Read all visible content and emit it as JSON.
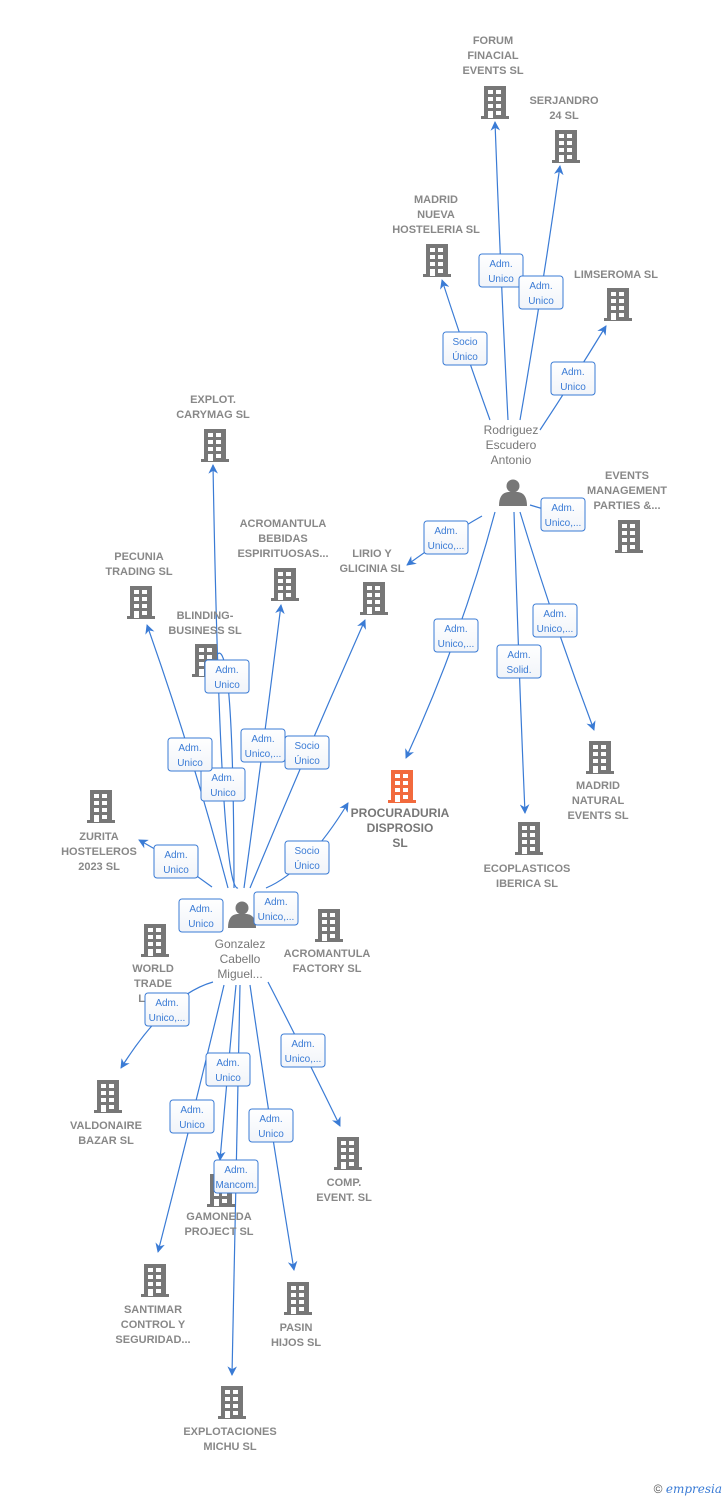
{
  "colors": {
    "edge": "#3a7bd5",
    "node": "#777777",
    "main_node": "#f26a3d",
    "label_border": "#3a7bd5"
  },
  "nodes": [
    {
      "id": "forum",
      "type": "company",
      "icon": "building-icon",
      "lines": [
        "FORUM",
        "FINACIAL",
        "EVENTS  SL"
      ]
    },
    {
      "id": "serjandro",
      "type": "company",
      "icon": "building-icon",
      "lines": [
        "SERJANDRO",
        "24 SL"
      ]
    },
    {
      "id": "madrid_nueva",
      "type": "company",
      "icon": "building-icon",
      "lines": [
        "MADRID",
        "NUEVA",
        "HOSTELERIA SL"
      ]
    },
    {
      "id": "limseroma",
      "type": "company",
      "icon": "building-icon",
      "lines": [
        "LIMSEROMA SL"
      ]
    },
    {
      "id": "rodriguez",
      "type": "person",
      "icon": "person-icon",
      "lines": [
        "Rodriguez",
        "Escudero",
        "Antonio"
      ]
    },
    {
      "id": "events_mgmt",
      "type": "company",
      "icon": "building-icon",
      "lines": [
        "EVENTS",
        "MANAGEMENT",
        "PARTIES &..."
      ]
    },
    {
      "id": "explot_carymag",
      "type": "company",
      "icon": "building-icon",
      "lines": [
        "EXPLOT.",
        "CARYMAG SL"
      ]
    },
    {
      "id": "acromantula_bebidas",
      "type": "company",
      "icon": "building-icon",
      "lines": [
        "ACROMANTULA",
        "BEBIDAS",
        "ESPIRITUOSAS..."
      ]
    },
    {
      "id": "pecunia",
      "type": "company",
      "icon": "building-icon",
      "lines": [
        "PECUNIA",
        "TRADING  SL"
      ]
    },
    {
      "id": "lirio",
      "type": "company",
      "icon": "building-icon",
      "lines": [
        "LIRIO Y",
        "GLICINIA  SL"
      ]
    },
    {
      "id": "blinding",
      "type": "company",
      "icon": "building-icon",
      "lines": [
        "BLINDING-",
        "BUSINESS  SL"
      ]
    },
    {
      "id": "procuraduria",
      "type": "main",
      "icon": "building-icon",
      "lines": [
        "PROCURADURIA",
        "DISPROSIO",
        "SL"
      ]
    },
    {
      "id": "madrid_natural",
      "type": "company",
      "icon": "building-icon",
      "lines": [
        "MADRID",
        "NATURAL",
        "EVENTS  SL"
      ]
    },
    {
      "id": "ecoplasticos",
      "type": "company",
      "icon": "building-icon",
      "lines": [
        "ECOPLASTICOS",
        "IBERICA  SL"
      ]
    },
    {
      "id": "zurita",
      "type": "company",
      "icon": "building-icon",
      "lines": [
        "ZURITA",
        "HOSTELEROS",
        "2023  SL"
      ]
    },
    {
      "id": "gonzalez",
      "type": "person",
      "icon": "person-icon",
      "lines": [
        "Gonzalez",
        "Cabello",
        "Miguel..."
      ]
    },
    {
      "id": "acromantula_factory",
      "type": "company",
      "icon": "building-icon",
      "lines": [
        "ACROMANTULA",
        "FACTORY  SL"
      ]
    },
    {
      "id": "world_trade",
      "type": "company",
      "icon": "building-icon",
      "lines": [
        "WORLD",
        "TRADE",
        "LEV..."
      ]
    },
    {
      "id": "valdonaire",
      "type": "company",
      "icon": "building-icon",
      "lines": [
        "VALDONAIRE",
        "BAZAR  SL"
      ]
    },
    {
      "id": "comp_event",
      "type": "company",
      "icon": "building-icon",
      "lines": [
        "COMP.",
        "EVENT.  SL"
      ]
    },
    {
      "id": "gamoneda",
      "type": "company",
      "icon": "building-icon",
      "lines": [
        "GAMONEDA",
        "PROJECT  SL"
      ]
    },
    {
      "id": "santimar",
      "type": "company",
      "icon": "building-icon",
      "lines": [
        "SANTIMAR",
        "CONTROL Y",
        "SEGURIDAD..."
      ]
    },
    {
      "id": "pasin",
      "type": "company",
      "icon": "building-icon",
      "lines": [
        "PASIN",
        "HIJOS SL"
      ]
    },
    {
      "id": "michu",
      "type": "company",
      "icon": "building-icon",
      "lines": [
        "EXPLOTACIONES",
        "MICHU SL"
      ]
    }
  ],
  "edges": [
    {
      "id": "e1",
      "from": "rodriguez",
      "to": "forum",
      "label": [
        "Adm.",
        "Unico"
      ]
    },
    {
      "id": "e2",
      "from": "rodriguez",
      "to": "serjandro",
      "label": [
        "Adm.",
        "Unico"
      ]
    },
    {
      "id": "e3",
      "from": "rodriguez",
      "to": "madrid_nueva",
      "label": [
        "Socio",
        "Único"
      ]
    },
    {
      "id": "e4",
      "from": "rodriguez",
      "to": "limseroma",
      "label": [
        "Adm.",
        "Unico"
      ]
    },
    {
      "id": "e5",
      "from": "rodriguez",
      "to": "lirio",
      "label": [
        "Adm.",
        "Unico,..."
      ]
    },
    {
      "id": "e6",
      "from": "rodriguez",
      "to": "events_mgmt",
      "label": [
        "Adm.",
        "Unico,..."
      ]
    },
    {
      "id": "e7",
      "from": "rodriguez",
      "to": "procuraduria",
      "label": [
        "Adm.",
        "Unico,..."
      ]
    },
    {
      "id": "e8",
      "from": "rodriguez",
      "to": "ecoplasticos",
      "label": [
        "Adm.",
        "Solid."
      ]
    },
    {
      "id": "e9",
      "from": "rodriguez",
      "to": "madrid_natural",
      "label": [
        "Adm.",
        "Unico,..."
      ]
    },
    {
      "id": "e10",
      "from": "gonzalez",
      "to": "explot_carymag",
      "label": [
        "Adm.",
        "Unico"
      ]
    },
    {
      "id": "e11",
      "from": "gonzalez",
      "to": "pecunia",
      "label": [
        "Adm.",
        "Unico"
      ]
    },
    {
      "id": "e12",
      "from": "gonzalez",
      "to": "blinding",
      "label": [
        "Adm.",
        "Unico"
      ]
    },
    {
      "id": "e13",
      "from": "gonzalez",
      "to": "acromantula_bebidas",
      "label": [
        "Adm.",
        "Unico,..."
      ]
    },
    {
      "id": "e14",
      "from": "gonzalez",
      "to": "lirio",
      "label": [
        "Socio",
        "Único"
      ]
    },
    {
      "id": "e15",
      "from": "gonzalez",
      "to": "zurita",
      "label": [
        "Adm.",
        "Unico"
      ]
    },
    {
      "id": "e16",
      "from": "gonzalez",
      "to": "procuraduria",
      "label": [
        "Socio",
        "Único"
      ]
    },
    {
      "id": "e17",
      "from": "gonzalez",
      "to": "world_trade",
      "label": [
        "Adm.",
        "Unico"
      ]
    },
    {
      "id": "e18",
      "from": "gonzalez",
      "to": "acromantula_factory",
      "label": [
        "Adm.",
        "Unico,..."
      ]
    },
    {
      "id": "e19",
      "from": "gonzalez",
      "to": "valdonaire",
      "label": [
        "Adm.",
        "Unico,..."
      ]
    },
    {
      "id": "e20",
      "from": "gonzalez",
      "to": "comp_event",
      "label": [
        "Adm.",
        "Unico,..."
      ]
    },
    {
      "id": "e21",
      "from": "gonzalez",
      "to": "gamoneda",
      "label": [
        "Adm.",
        "Unico"
      ]
    },
    {
      "id": "e22",
      "from": "gonzalez",
      "to": "santimar",
      "label": [
        "Adm.",
        "Unico"
      ]
    },
    {
      "id": "e23",
      "from": "gonzalez",
      "to": "pasin",
      "label": [
        "Adm.",
        "Unico"
      ]
    },
    {
      "id": "e24",
      "from": "gonzalez",
      "to": "michu",
      "label": [
        "Adm.",
        "Mancom."
      ]
    }
  ],
  "footer": {
    "copyright": "©",
    "brand": "empresia"
  }
}
